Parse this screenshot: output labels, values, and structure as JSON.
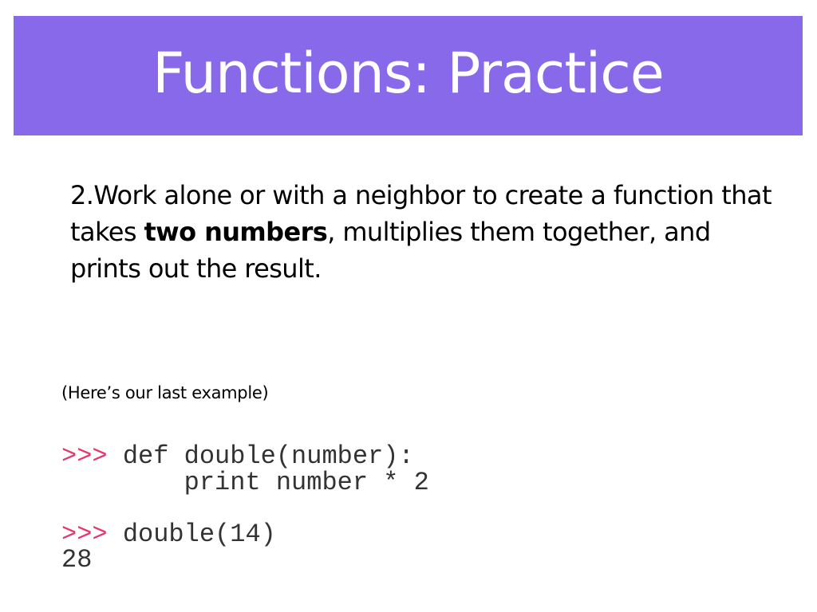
{
  "slide": {
    "title": "Functions: Practice",
    "prompt": {
      "number": "2.",
      "text_before": "Work alone or with a neighbor to create a function that takes ",
      "bold": "two numbers",
      "text_after": ", multiplies them together, and prints out the result."
    },
    "caption": "(Here’s our last example)",
    "code": {
      "prompt_symbol": ">>>",
      "line1": " def double(number):",
      "line2": "        print number * 2",
      "line3": "",
      "line4": " double(14)",
      "line5": "28"
    }
  },
  "colors": {
    "banner": "#8769EA",
    "title_text": "#FFFFFF",
    "prompt_symbol": "#E8366B"
  }
}
